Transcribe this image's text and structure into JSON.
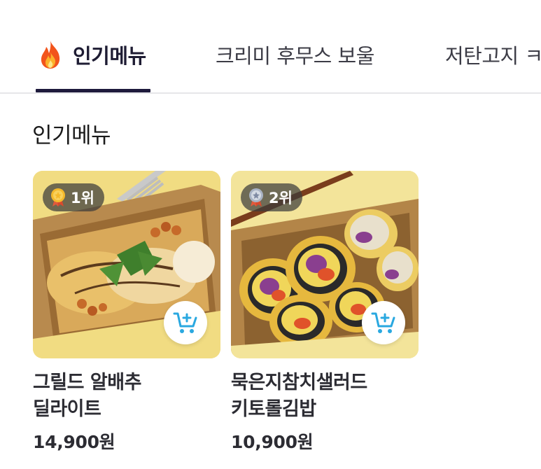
{
  "tabs": [
    {
      "label": "인기메뉴",
      "icon": "fire-icon",
      "active": true
    },
    {
      "label": "크리미 후무스 보울",
      "active": false
    },
    {
      "label": "저탄고지 ㅋ",
      "active": false
    }
  ],
  "section": {
    "title": "인기메뉴"
  },
  "products": [
    {
      "rank_label": "1위",
      "rank_icon": "gold-medal-icon",
      "name_line1": "그릴드 알배추",
      "name_line2": "딜라이트",
      "price": "14,900원",
      "cart_icon": "add-to-cart-icon"
    },
    {
      "rank_label": "2위",
      "rank_icon": "silver-medal-icon",
      "name_line1": "묵은지참치샐러드",
      "name_line2": "키토롤김밥",
      "price": "10,900원",
      "cart_icon": "add-to-cart-icon"
    }
  ],
  "colors": {
    "active_tab": "#1e1a3c",
    "cart_icon": "#2aa8e0",
    "text": "#2c2c33"
  }
}
